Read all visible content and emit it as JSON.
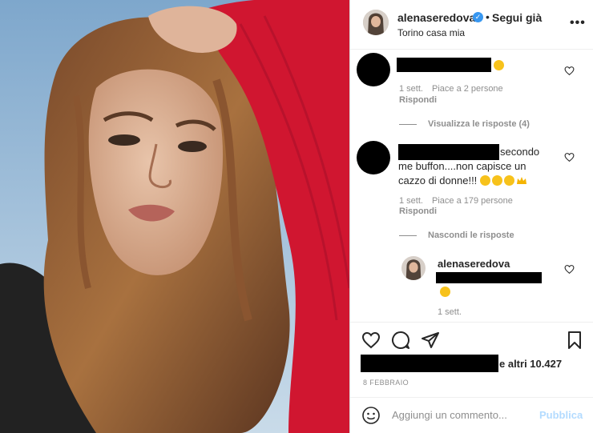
{
  "post": {
    "photo_alt": "photo",
    "username": "alenaseredova",
    "follow_label": "Segui già",
    "location": "Torino casa mia",
    "more_label": "•••"
  },
  "comments": [
    {
      "text": "",
      "time": "1 sett.",
      "likes": "Piace a 2 persone",
      "reply_label": "Rispondi"
    },
    {
      "text": "secondo me buffon....non capisce un cazzo di donne!!!",
      "time": "1 sett.",
      "likes": "Piace a 179 persone",
      "reply_label": "Rispondi"
    }
  ],
  "threads": {
    "view_replies": "Visualizza le risposte (4)",
    "hide_replies": "Nascondi le risposte"
  },
  "reply": {
    "username": "alenaseredova",
    "time": "1 sett."
  },
  "actions": {
    "likes_suffix": "e altri 10.427",
    "date": "8 FEBBRAIO"
  },
  "add_comment": {
    "placeholder": "Aggiungi un commento...",
    "publish_label": "Pubblica"
  },
  "colors": {
    "accent": "#3897f0",
    "publish_disabled": "#b3dbff",
    "muted": "#8e8e8e",
    "text": "#262626"
  }
}
